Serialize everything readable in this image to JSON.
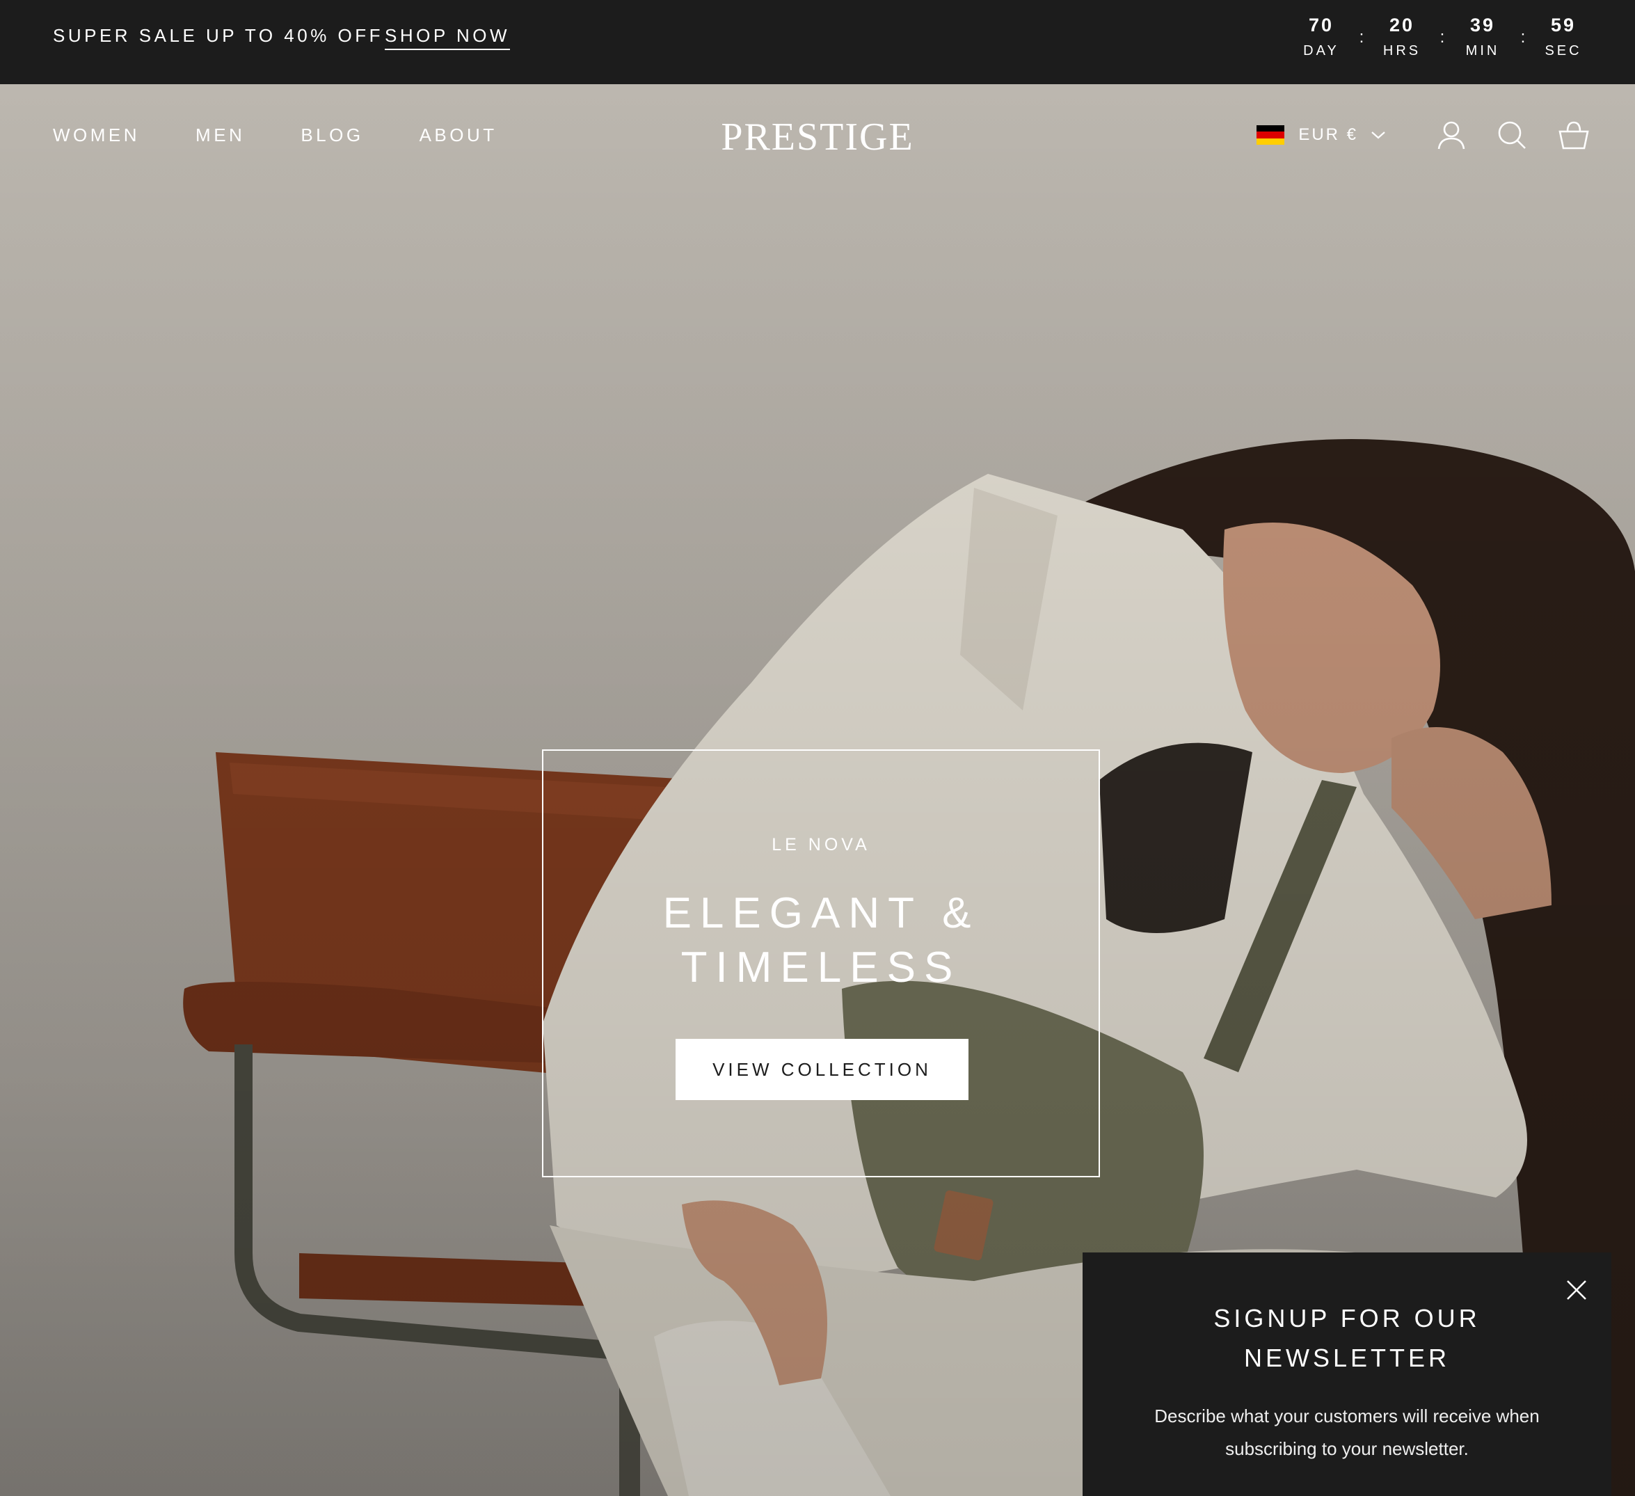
{
  "announcement": {
    "text": "SUPER SALE UP TO 40% OFF",
    "link": "SHOP NOW"
  },
  "countdown": [
    {
      "value": "70",
      "label": "DAY"
    },
    {
      "value": "20",
      "label": "HRS"
    },
    {
      "value": "39",
      "label": "MIN"
    },
    {
      "value": "59",
      "label": "SEC"
    }
  ],
  "countdown_separator": ":",
  "nav": {
    "items": [
      "WOMEN",
      "MEN",
      "BLOG",
      "ABOUT"
    ]
  },
  "logo": "PRESTIGE",
  "header_right": {
    "currency": "EUR €",
    "icons": [
      "de-flag-icon",
      "chevron-down-icon",
      "account-icon",
      "search-icon",
      "cart-icon"
    ]
  },
  "hero": {
    "subtitle": "LE NOVA",
    "title_line1": "ELEGANT &",
    "title_line2": "TIMELESS",
    "button": "VIEW COLLECTION"
  },
  "newsletter": {
    "title_line1": "SIGNUP FOR OUR",
    "title_line2": "NEWSLETTER",
    "text_line1": "Describe what your customers will receive when",
    "text_line2": "subscribing to your newsletter."
  },
  "colors": {
    "dark": "#1c1c1c",
    "white": "#ffffff",
    "flag_black": "#000000",
    "flag_red": "#dd0000",
    "flag_gold": "#ffce00"
  }
}
